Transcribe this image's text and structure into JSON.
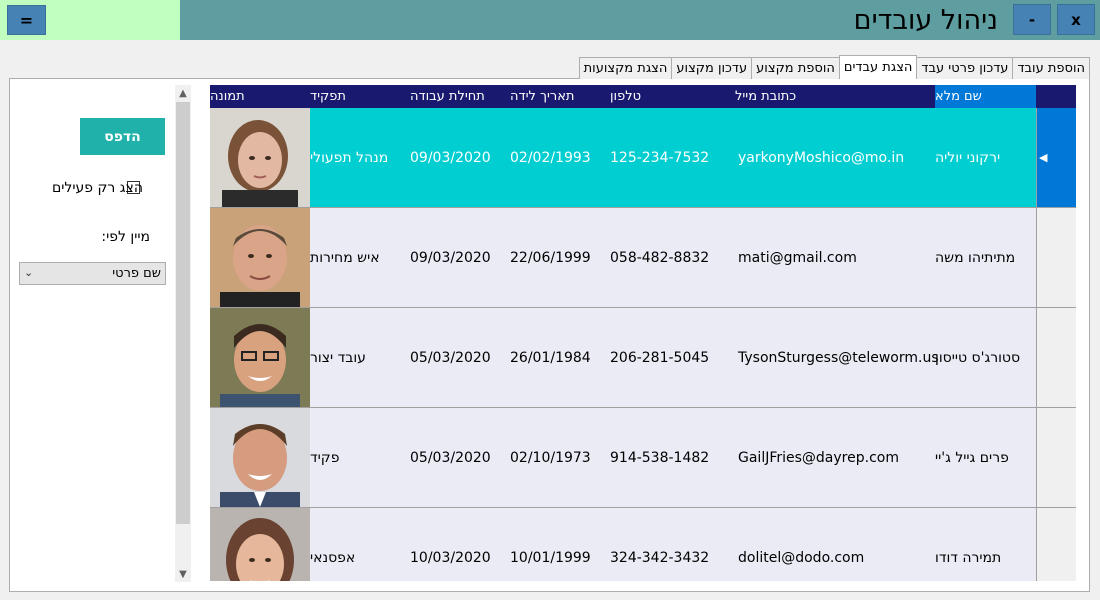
{
  "window": {
    "title": "ניהול עובדים",
    "menu_label": "=",
    "minimize_label": "-",
    "close_label": "x"
  },
  "tabs": [
    {
      "label": "הוספת עובד",
      "active": false
    },
    {
      "label": "עדכון פרטי עבד",
      "active": false
    },
    {
      "label": "הצגת עבדים",
      "active": true
    },
    {
      "label": "הוספת מקצוע",
      "active": false
    },
    {
      "label": "עדכון מקצוע",
      "active": false
    },
    {
      "label": "הצגת מקצועות",
      "active": false
    }
  ],
  "controls": {
    "print_label": "הדפס",
    "active_only_label": "הצג רק פעילים",
    "active_only_checked": false,
    "sort_label": "מיין לפי:",
    "sort_value": "שם פרטי"
  },
  "grid": {
    "columns": {
      "name": "שם מלא",
      "email": "כתובת מייל",
      "phone": "טלפון",
      "birth": "תאריך לידה",
      "start": "תחילת עבודה",
      "role": "תפקיד",
      "photo": "תמונה"
    },
    "rows": [
      {
        "name": "ירקוני יוליה",
        "email": "yarkonyMoshico@mo.in",
        "phone": "125-234-7532",
        "birth": "02/02/1993",
        "start": "09/03/2020",
        "role": "מנהל תפעולי",
        "selected": true
      },
      {
        "name": "מתיתיהו משה",
        "email": "mati@gmail.com",
        "phone": "058-482-8832",
        "birth": "22/06/1999",
        "start": "09/03/2020",
        "role": "איש מחירות",
        "selected": false
      },
      {
        "name": "סטורג'ס טייסון",
        "email": "TysonSturgess@teleworm.us",
        "phone": "206-281-5045",
        "birth": "26/01/1984",
        "start": "05/03/2020",
        "role": "עובד יצור",
        "selected": false
      },
      {
        "name": "פרים גייל ג'יי",
        "email": "GailJFries@dayrep.com",
        "phone": "914-538-1482",
        "birth": "02/10/1973",
        "start": "05/03/2020",
        "role": "פקיד",
        "selected": false
      },
      {
        "name": "תמירה דודו",
        "email": "dolitel@dodo.com",
        "phone": "324-342-3432",
        "birth": "10/01/1999",
        "start": "10/03/2020",
        "role": "אפסנאי",
        "selected": false
      }
    ]
  },
  "colors": {
    "title_bar": "#5f9ea0",
    "title_left": "#c0ffc0",
    "buttons": "#4682b4",
    "header": "#191970",
    "selected_row": "#00ced1",
    "print_button": "#20b2aa"
  }
}
